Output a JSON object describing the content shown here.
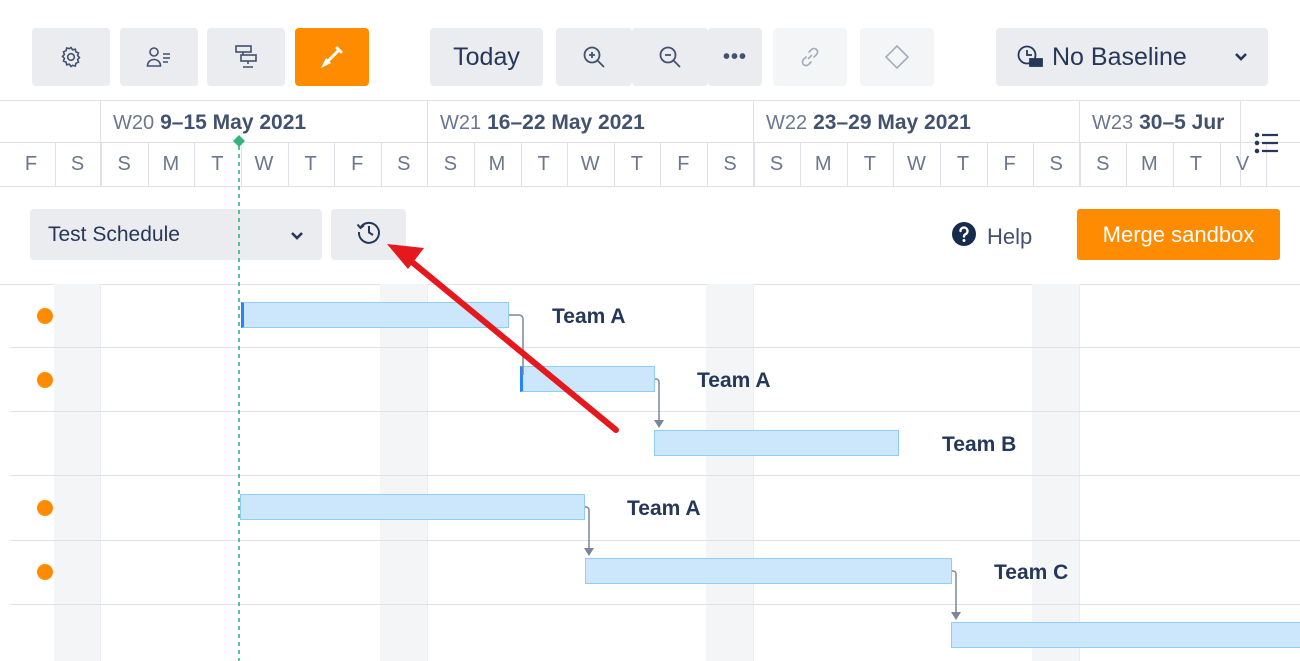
{
  "toolbar": {
    "settings_icon": "gear-icon",
    "resources_icon": "user-list-icon",
    "hierarchy_icon": "hierarchy-icon",
    "sandbox_icon": "shovel-icon",
    "today_label": "Today",
    "zoom_in_icon": "zoom-in-icon",
    "zoom_out_icon": "zoom-out-icon",
    "more_label": "•••",
    "link_icon": "link-icon",
    "milestone_icon": "diamond-icon",
    "baseline_label": "No Baseline",
    "accent_color": "#ff8b00"
  },
  "timeline": {
    "weeks": [
      {
        "week": "W20",
        "range": "9–15 May 2021"
      },
      {
        "week": "W21",
        "range": "16–22 May 2021"
      },
      {
        "week": "W22",
        "range": "23–29 May 2021"
      },
      {
        "week": "W23",
        "range": "30–5 Jur"
      }
    ],
    "days": [
      "F",
      "S",
      "S",
      "M",
      "T",
      "W",
      "T",
      "F",
      "S",
      "S",
      "M",
      "T",
      "W",
      "T",
      "F",
      "S",
      "S",
      "M",
      "T",
      "W",
      "T",
      "F",
      "S",
      "S",
      "M",
      "T",
      "V"
    ]
  },
  "filterbar": {
    "schedule_select": "Test Schedule",
    "history_icon": "history-icon",
    "help_label": "Help",
    "merge_label": "Merge sandbox"
  },
  "gantt": {
    "rows": [
      {
        "team": "Team A",
        "risk_dot": true
      },
      {
        "team": "Team A",
        "risk_dot": true
      },
      {
        "team": "Team B",
        "risk_dot": false
      },
      {
        "team": "Team A",
        "risk_dot": true
      },
      {
        "team": "Team C",
        "risk_dot": true
      },
      {
        "team": "",
        "risk_dot": false
      }
    ],
    "today_marker_color": "#36b37e",
    "risk_color": "#ff8b00",
    "annotation_arrow_color": "#e5181d"
  }
}
